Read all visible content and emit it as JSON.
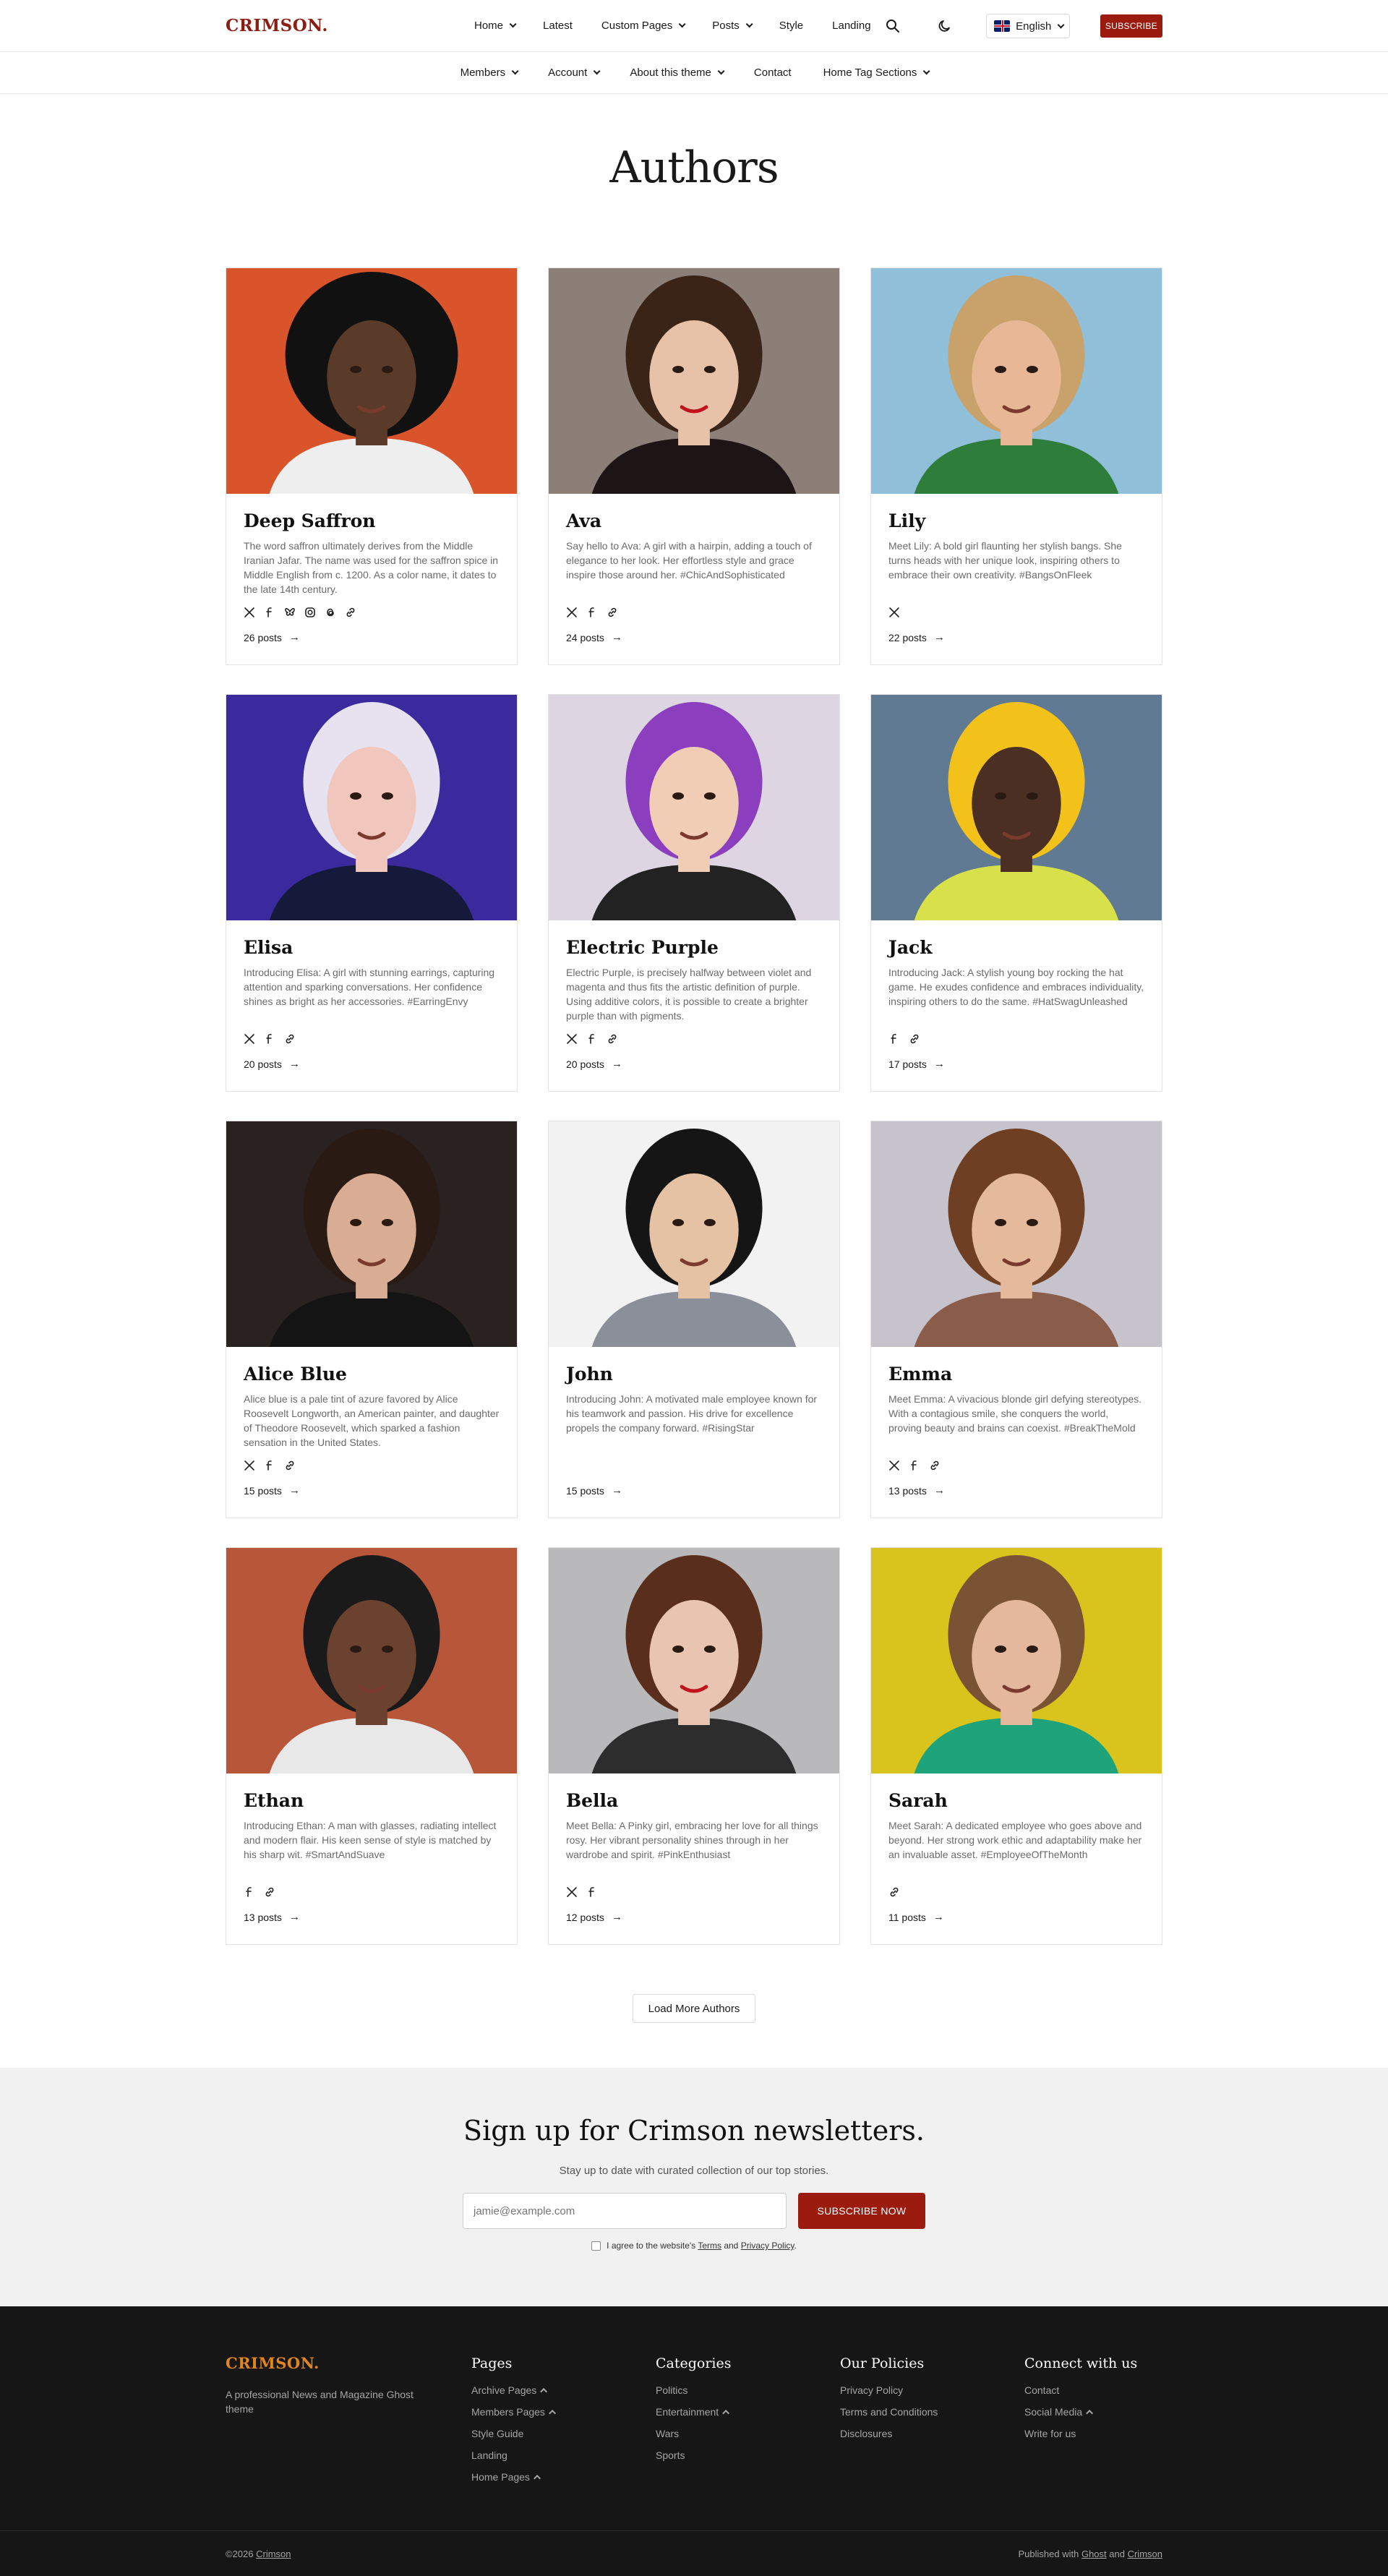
{
  "header": {
    "logo": "CRIMSON.",
    "nav": [
      {
        "label": "Home",
        "dropdown": true
      },
      {
        "label": "Latest",
        "dropdown": false
      },
      {
        "label": "Custom Pages",
        "dropdown": true
      },
      {
        "label": "Posts",
        "dropdown": true
      },
      {
        "label": "Style",
        "dropdown": false
      },
      {
        "label": "Landing",
        "dropdown": false
      }
    ],
    "language": "English",
    "subscribe_label": "SUBSCRIBE",
    "subnav": [
      {
        "label": "Members",
        "dropdown": true
      },
      {
        "label": "Account",
        "dropdown": true
      },
      {
        "label": "About this theme",
        "dropdown": true
      },
      {
        "label": "Contact",
        "dropdown": false
      },
      {
        "label": "Home Tag Sections",
        "dropdown": true
      }
    ]
  },
  "page_title": "Authors",
  "authors": [
    {
      "name": "Deep Saffron",
      "bio": "The word saffron ultimately derives from the Middle Iranian Jafar. The name was used for the saffron spice in Middle English from c. 1200. As a color name, it dates to the late 14th century.",
      "socials": [
        "x-icon",
        "facebook-icon",
        "bluesky-icon",
        "instagram-icon",
        "threads-icon",
        "link-icon"
      ],
      "posts": "26 posts",
      "bg": "#d9542b"
    },
    {
      "name": "Ava",
      "bio": "Say hello to Ava: A girl with a hairpin, adding a touch of elegance to her look. Her effortless style and grace inspire those around her. #ChicAndSophisticated",
      "socials": [
        "x-icon",
        "facebook-icon",
        "link-icon"
      ],
      "posts": "24 posts",
      "bg": "#8b7f78"
    },
    {
      "name": "Lily",
      "bio": "Meet Lily: A bold girl flaunting her stylish bangs. She turns heads with her unique look, inspiring others to embrace their own creativity. #BangsOnFleek",
      "socials": [
        "x-icon"
      ],
      "posts": "22 posts",
      "bg": "#8fbfd9"
    },
    {
      "name": "Elisa",
      "bio": "Introducing Elisa: A girl with stunning earrings, capturing attention and sparking conversations. Her confidence shines as bright as her accessories. #EarringEnvy",
      "socials": [
        "x-icon",
        "facebook-icon",
        "link-icon"
      ],
      "posts": "20 posts",
      "bg": "#3b2a9e"
    },
    {
      "name": "Electric Purple",
      "bio": "Electric Purple, is precisely halfway between violet and magenta and thus fits the artistic definition of purple. Using additive colors, it is possible to create a brighter purple than with pigments.",
      "socials": [
        "x-icon",
        "facebook-icon",
        "link-icon"
      ],
      "posts": "20 posts",
      "bg": "#ddd6e2"
    },
    {
      "name": "Jack",
      "bio": "Introducing Jack: A stylish young boy rocking the hat game. He exudes confidence and embraces individuality, inspiring others to do the same. #HatSwagUnleashed",
      "socials": [
        "facebook-icon",
        "link-icon"
      ],
      "posts": "17 posts",
      "bg": "#5f7a92"
    },
    {
      "name": "Alice Blue",
      "bio": "Alice blue is a pale tint of azure favored by Alice Roosevelt Longworth, an American painter, and daughter of Theodore Roosevelt, which sparked a fashion sensation in the United States.",
      "socials": [
        "x-icon",
        "facebook-icon",
        "link-icon"
      ],
      "posts": "15 posts",
      "bg": "#2a2220"
    },
    {
      "name": "John",
      "bio": "Introducing John: A motivated male employee known for his teamwork and passion. His drive for excellence propels the company forward. #RisingStar",
      "socials": [],
      "posts": "15 posts",
      "bg": "#f2f2f2"
    },
    {
      "name": "Emma",
      "bio": "Meet Emma: A vivacious blonde girl defying stereotypes. With a contagious smile, she conquers the world, proving beauty and brains can coexist. #BreakTheMold",
      "socials": [
        "x-icon",
        "facebook-icon",
        "link-icon"
      ],
      "posts": "13 posts",
      "bg": "#c7c3cc"
    },
    {
      "name": "Ethan",
      "bio": "Introducing Ethan: A man with glasses, radiating intellect and modern flair. His keen sense of style is matched by his sharp wit. #SmartAndSuave",
      "socials": [
        "facebook-icon",
        "link-icon"
      ],
      "posts": "13 posts",
      "bg": "#b8563a"
    },
    {
      "name": "Bella",
      "bio": "Meet Bella: A Pinky girl, embracing her love for all things rosy. Her vibrant personality shines through in her wardrobe and spirit. #PinkEnthusiast",
      "socials": [
        "x-icon",
        "facebook-icon"
      ],
      "posts": "12 posts",
      "bg": "#b9b9bb"
    },
    {
      "name": "Sarah",
      "bio": "Meet Sarah: A dedicated employee who goes above and beyond. Her strong work ethic and adaptability make her an invaluable asset. #EmployeeOfTheMonth",
      "socials": [
        "link-icon"
      ],
      "posts": "11 posts",
      "bg": "#d8c41c"
    }
  ],
  "load_more_label": "Load More Authors",
  "newsletter": {
    "title": "Sign up for Crimson newsletters.",
    "subtitle": "Stay up to date with curated collection of our top stories.",
    "email_placeholder": "jamie@example.com",
    "button_label": "SUBSCRIBE NOW",
    "consent_prefix": "I agree to the website's",
    "consent_terms": "Terms",
    "consent_and": "and",
    "consent_privacy": "Privacy Policy",
    "consent_suffix": "."
  },
  "footer": {
    "logo": "CRIMSON.",
    "tagline": "A professional News and Magazine Ghost theme",
    "columns": [
      {
        "title": "Pages",
        "links": [
          {
            "label": "Archive Pages",
            "expand": true
          },
          {
            "label": "Members Pages",
            "expand": true
          },
          {
            "label": "Style Guide",
            "expand": false
          },
          {
            "label": "Landing",
            "expand": false
          },
          {
            "label": "Home Pages",
            "expand": true
          }
        ]
      },
      {
        "title": "Categories",
        "links": [
          {
            "label": "Politics",
            "expand": false
          },
          {
            "label": "Entertainment",
            "expand": true
          },
          {
            "label": "Wars",
            "expand": false
          },
          {
            "label": "Sports",
            "expand": false
          }
        ]
      },
      {
        "title": "Our Policies",
        "links": [
          {
            "label": "Privacy Policy",
            "expand": false
          },
          {
            "label": "Terms and Conditions",
            "expand": false
          },
          {
            "label": "Disclosures",
            "expand": false
          }
        ]
      },
      {
        "title": "Connect with us",
        "links": [
          {
            "label": "Contact",
            "expand": false
          },
          {
            "label": "Social Media",
            "expand": true
          },
          {
            "label": "Write for us",
            "expand": false
          }
        ]
      }
    ],
    "copyright_prefix": "©2026",
    "copyright_link": "Crimson",
    "published_prefix": "Published with",
    "published_ghost": "Ghost",
    "published_and": "and",
    "published_crimson": "Crimson"
  },
  "colors": {
    "brand": "#9b1b0f",
    "footer_logo": "#e0851f",
    "footer_bg": "#161616",
    "newsletter_bg": "#f1f1f1"
  }
}
